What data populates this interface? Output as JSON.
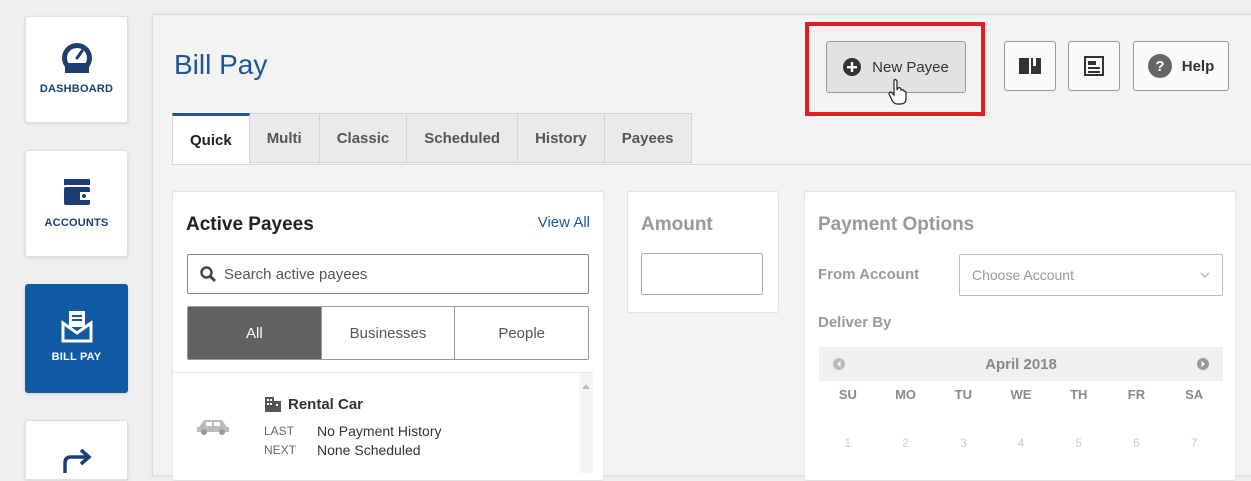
{
  "sidebar": {
    "items": [
      {
        "label": "DASHBOARD",
        "icon": "speedometer-icon"
      },
      {
        "label": "ACCOUNTS",
        "icon": "wallet-icon"
      },
      {
        "label": "BILL PAY",
        "icon": "envelope-bill-icon",
        "active": true
      },
      {
        "label": "",
        "icon": "transfer-arrow-icon"
      }
    ]
  },
  "header": {
    "title": "Bill Pay",
    "new_payee_label": "New Payee",
    "help_label": "Help"
  },
  "tabs": [
    {
      "label": "Quick",
      "active": true
    },
    {
      "label": "Multi"
    },
    {
      "label": "Classic"
    },
    {
      "label": "Scheduled"
    },
    {
      "label": "History"
    },
    {
      "label": "Payees"
    }
  ],
  "payees": {
    "title": "Active Payees",
    "view_all": "View All",
    "search_placeholder": "Search active payees",
    "filters": [
      {
        "label": "All",
        "active": true
      },
      {
        "label": "Businesses"
      },
      {
        "label": "People"
      }
    ],
    "items": [
      {
        "name": "Rental Car",
        "last_label": "LAST",
        "last_value": "No Payment History",
        "next_label": "NEXT",
        "next_value": "None Scheduled"
      }
    ]
  },
  "amount": {
    "title": "Amount",
    "value": ""
  },
  "payment_options": {
    "title": "Payment Options",
    "from_account_label": "From Account",
    "from_account_placeholder": "Choose Account",
    "deliver_by_label": "Deliver By",
    "calendar": {
      "month": "April 2018",
      "weekdays": [
        "SU",
        "MO",
        "TU",
        "WE",
        "TH",
        "FR",
        "SA"
      ],
      "dates": [
        "1",
        "2",
        "3",
        "4",
        "5",
        "6",
        "7"
      ]
    }
  },
  "colors": {
    "brand_blue": "#1c5794",
    "active_nav": "#0f5aa3",
    "highlight_red": "#e41c25"
  }
}
